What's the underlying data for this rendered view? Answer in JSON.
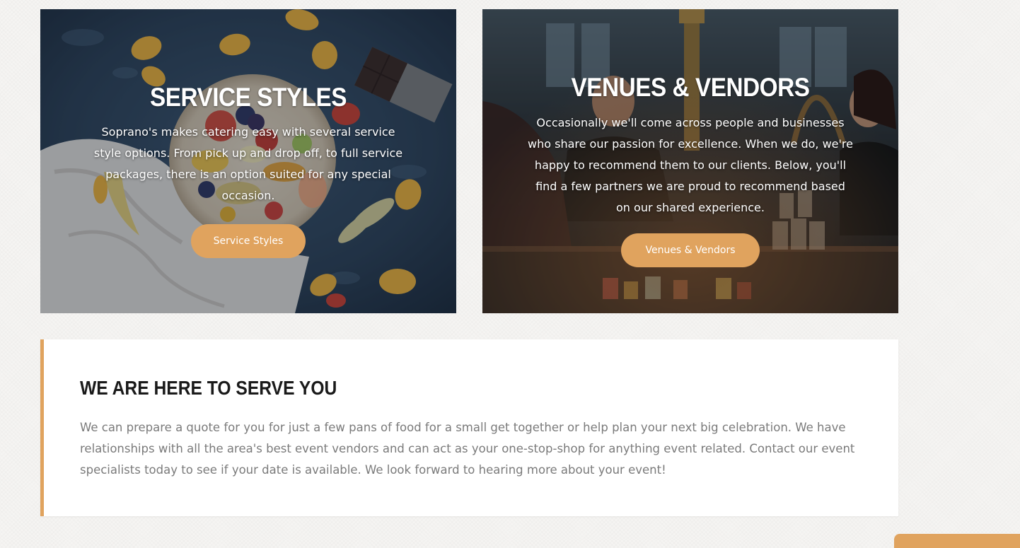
{
  "service_styles": {
    "title": "SERVICE STYLES",
    "description": "Soprano's makes catering easy with several service style options. From pick up and drop off, to full service packages, there is an option suited for any special occasion.",
    "button_label": "Service Styles"
  },
  "venues_vendors": {
    "title": "VENUES & VENDORS",
    "description": "Occasionally we'll come across people and businesses who share our passion for excellence. When we do, we're happy to recommend them to our clients. Below, you'll find a few partners we are proud to recommend based on our shared experience.",
    "button_label": "Venues & Vendors"
  },
  "serve_section": {
    "heading": "WE ARE HERE TO SERVE YOU",
    "body": "We can prepare a quote for you for just a few pans of food for a small get together or help plan your next big celebration. We have relationships with all the area's best event vendors and can act as your one-stop-shop for anything event related. Contact our event specialists today to see if your date is available. We look forward to hearing more about your event!"
  },
  "colors": {
    "accent": "#e0a35e",
    "page_background": "#f5f4f2",
    "heading_text": "#1a1a1a",
    "body_text": "#7a7a7a"
  }
}
